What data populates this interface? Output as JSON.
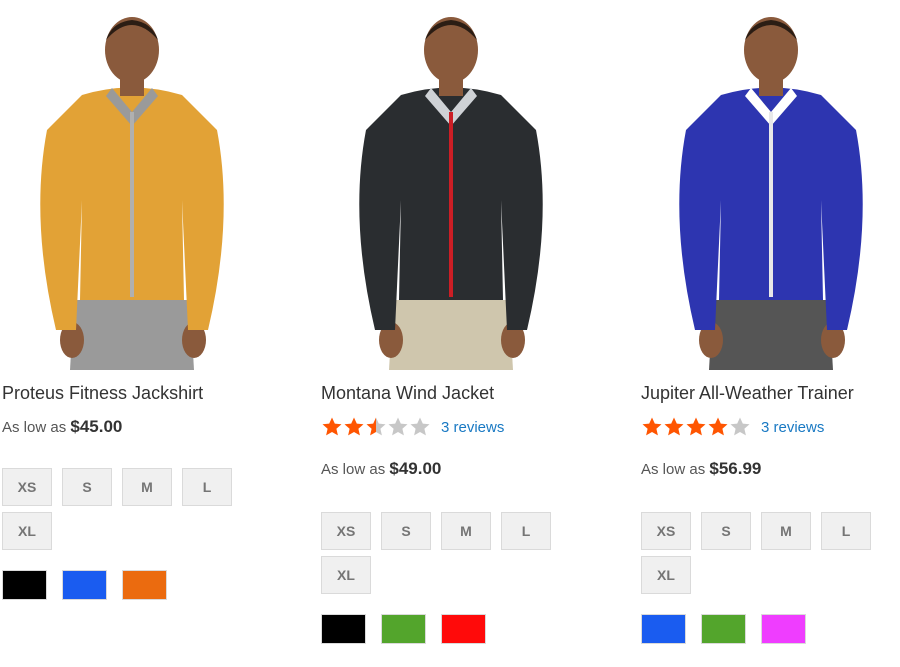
{
  "products": [
    {
      "name": "Proteus Fitness Jackshirt",
      "price_label": "As low as",
      "price": "$45.00",
      "rating": null,
      "reviews": null,
      "sizes": [
        "XS",
        "S",
        "M",
        "L",
        "XL"
      ],
      "swatches": [
        "#000000",
        "#1a5cf0",
        "#eb6b0f"
      ],
      "image": {
        "garment": "#e2a236",
        "collar": "#9a9a9a",
        "zip": "#b0b0b0",
        "pants": "#9a9a9a"
      }
    },
    {
      "name": "Montana Wind Jacket",
      "price_label": "As low as",
      "price": "$49.00",
      "rating": 2.5,
      "reviews": "3 reviews",
      "sizes": [
        "XS",
        "S",
        "M",
        "L",
        "XL"
      ],
      "swatches": [
        "#000000",
        "#53a52c",
        "#ff0a0a"
      ],
      "image": {
        "garment": "#2a2d30",
        "collar": "#cfd2d6",
        "zip": "#cc1e25",
        "pants": "#cfc6ad"
      }
    },
    {
      "name": "Jupiter All-Weather Trainer",
      "price_label": "As low as",
      "price": "$56.99",
      "rating": 4,
      "reviews": "3 reviews",
      "sizes": [
        "XS",
        "S",
        "M",
        "L",
        "XL"
      ],
      "swatches": [
        "#1a5cf0",
        "#53a52c",
        "#ef3dff"
      ],
      "image": {
        "garment": "#2d35b0",
        "collar": "#ffffff",
        "zip": "#e8e8e8",
        "pants": "#555555"
      }
    }
  ],
  "colors": {
    "star_on": "#ff5501",
    "star_off": "#c7c7c7",
    "link": "#1979c3"
  }
}
